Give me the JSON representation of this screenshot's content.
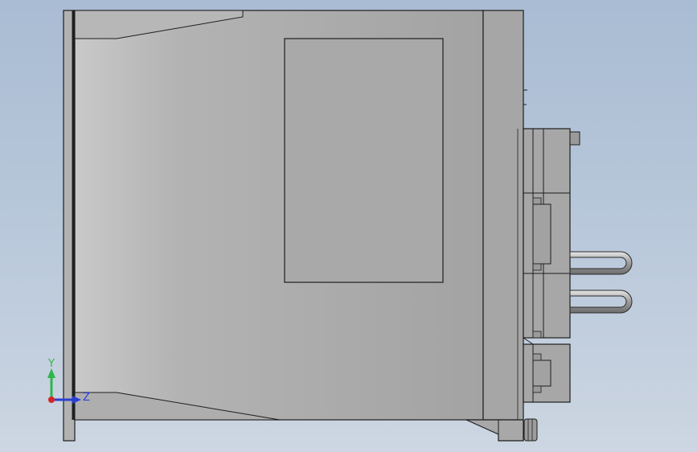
{
  "viewport": {
    "background_top": "#a9bcd3",
    "background_bottom": "#cdd6e2",
    "part_color": "#a9a9a9",
    "edge_color": "#1e1e1e"
  },
  "triad": {
    "y_label": "Y",
    "z_label": "Z",
    "y_color": "#2fb64a",
    "z_color": "#2a3fd6",
    "x_color": "#d42626"
  }
}
